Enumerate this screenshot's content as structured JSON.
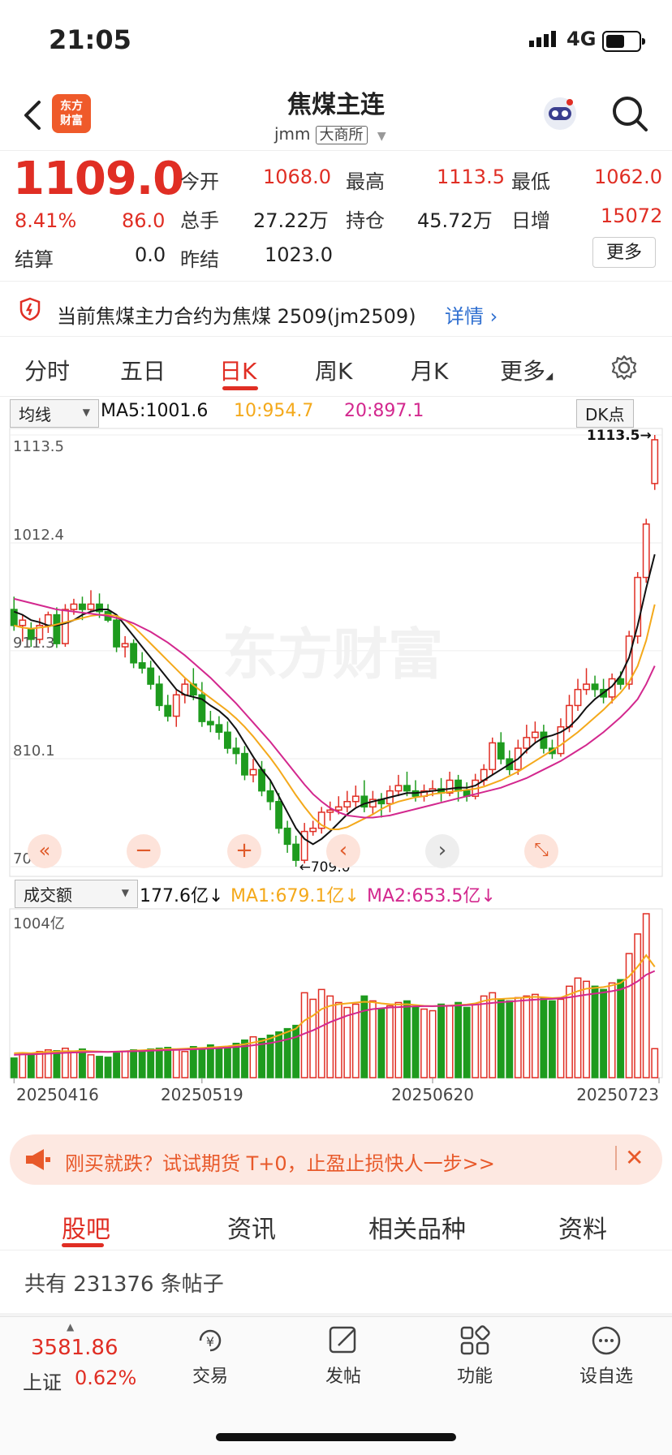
{
  "status": {
    "time": "21:05",
    "network": "4G"
  },
  "header": {
    "title": "焦煤主连",
    "code": "jmm",
    "exchange": "大商所",
    "logo": "东方财富"
  },
  "quote": {
    "price": "1109.0",
    "change_pct": "8.41%",
    "change": "86.0",
    "open_label": "今开",
    "open": "1068.0",
    "high_label": "最高",
    "high": "1113.5",
    "low_label": "最低",
    "low": "1062.0",
    "volume_label": "总手",
    "volume": "27.22万",
    "oi_label": "持仓",
    "oi": "45.72万",
    "daily_inc_label": "日增",
    "daily_inc": "15072",
    "settle_label": "结算",
    "settle": "0.0",
    "prev_settle_label": "昨结",
    "prev_settle": "1023.0",
    "more": "更多"
  },
  "notice": {
    "text": "当前焦煤主力合约为焦煤 2509(jm2509)",
    "link": "详情"
  },
  "tabs": [
    "分时",
    "五日",
    "日K",
    "周K",
    "月K",
    "更多",
    "gear-icon"
  ],
  "ma_bar": {
    "selector": "均线",
    "ma5": "MA5:1001.6",
    "ma10": "10:954.7",
    "ma20": "20:897.1",
    "dk": "DK点"
  },
  "vol_bar": {
    "selector": "成交额",
    "value": "177.6亿",
    "ma1": "MA1:679.1亿",
    "ma2": "MA2:653.5亿"
  },
  "chart_data": {
    "type": "candlestick",
    "price_ticks": [
      "1113.5",
      "1012.4",
      "911.3",
      "810.1",
      "709.0"
    ],
    "ylim": [
      709.0,
      1113.5
    ],
    "high_marker": "1113.5",
    "low_marker": "709.0",
    "vol_max_label": "1004亿",
    "vol_max": 1004,
    "dates": [
      "20250416",
      "20250519",
      "20250620",
      "20250723"
    ],
    "candles": [
      [
        950,
        935,
        962,
        930
      ],
      [
        935,
        940,
        945,
        920
      ],
      [
        932,
        922,
        938,
        915
      ],
      [
        922,
        935,
        942,
        918
      ],
      [
        935,
        945,
        948,
        928
      ],
      [
        945,
        918,
        952,
        914
      ],
      [
        918,
        950,
        955,
        915
      ],
      [
        950,
        955,
        960,
        945
      ],
      [
        955,
        950,
        962,
        940
      ],
      [
        950,
        955,
        968,
        948
      ],
      [
        955,
        948,
        965,
        942
      ],
      [
        948,
        940,
        955,
        938
      ],
      [
        940,
        915,
        945,
        910
      ],
      [
        915,
        918,
        925,
        905
      ],
      [
        918,
        900,
        922,
        895
      ],
      [
        900,
        895,
        910,
        890
      ],
      [
        895,
        880,
        902,
        875
      ],
      [
        880,
        860,
        888,
        855
      ],
      [
        860,
        850,
        870,
        845
      ],
      [
        850,
        870,
        875,
        840
      ],
      [
        870,
        880,
        885,
        862
      ],
      [
        880,
        870,
        895,
        865
      ],
      [
        870,
        845,
        882,
        840
      ],
      [
        845,
        842,
        855,
        835
      ],
      [
        842,
        835,
        850,
        828
      ],
      [
        835,
        820,
        845,
        815
      ],
      [
        820,
        815,
        830,
        805
      ],
      [
        815,
        795,
        822,
        790
      ],
      [
        795,
        800,
        810,
        788
      ],
      [
        800,
        780,
        808,
        775
      ],
      [
        780,
        770,
        790,
        762
      ],
      [
        770,
        745,
        778,
        740
      ],
      [
        745,
        730,
        752,
        722
      ],
      [
        730,
        715,
        738,
        709
      ],
      [
        715,
        742,
        750,
        712
      ],
      [
        742,
        745,
        752,
        738
      ],
      [
        745,
        760,
        765,
        740
      ],
      [
        760,
        762,
        770,
        752
      ],
      [
        762,
        765,
        775,
        758
      ],
      [
        765,
        770,
        780,
        760
      ],
      [
        770,
        775,
        785,
        765
      ],
      [
        775,
        765,
        790,
        760
      ],
      [
        765,
        772,
        780,
        758
      ],
      [
        772,
        768,
        778,
        755
      ],
      [
        768,
        780,
        785,
        760
      ],
      [
        780,
        785,
        795,
        775
      ],
      [
        785,
        780,
        798,
        775
      ],
      [
        780,
        775,
        790,
        770
      ],
      [
        775,
        780,
        786,
        770
      ],
      [
        780,
        782,
        790,
        775
      ],
      [
        782,
        778,
        792,
        770
      ],
      [
        778,
        790,
        798,
        775
      ],
      [
        790,
        780,
        795,
        770
      ],
      [
        780,
        775,
        788,
        770
      ],
      [
        775,
        790,
        796,
        772
      ],
      [
        790,
        800,
        805,
        785
      ],
      [
        800,
        825,
        830,
        795
      ],
      [
        825,
        810,
        835,
        805
      ],
      [
        810,
        800,
        818,
        795
      ],
      [
        800,
        820,
        828,
        795
      ],
      [
        820,
        830,
        842,
        815
      ],
      [
        830,
        835,
        845,
        825
      ],
      [
        835,
        820,
        842,
        815
      ],
      [
        820,
        815,
        828,
        810
      ],
      [
        815,
        840,
        848,
        812
      ],
      [
        840,
        860,
        870,
        835
      ],
      [
        860,
        875,
        885,
        855
      ],
      [
        875,
        880,
        895,
        870
      ],
      [
        880,
        875,
        888,
        868
      ],
      [
        875,
        868,
        885,
        862
      ],
      [
        868,
        885,
        890,
        862
      ],
      [
        885,
        880,
        892,
        875
      ],
      [
        880,
        925,
        930,
        875
      ],
      [
        925,
        980,
        985,
        918
      ],
      [
        980,
        1030,
        1035,
        975
      ],
      [
        1068,
        1109,
        1113.5,
        1062
      ]
    ],
    "volume": [
      120,
      150,
      140,
      160,
      170,
      165,
      180,
      160,
      175,
      140,
      130,
      125,
      150,
      160,
      170,
      165,
      175,
      180,
      185,
      170,
      160,
      190,
      175,
      200,
      185,
      190,
      210,
      230,
      250,
      240,
      260,
      280,
      300,
      320,
      520,
      480,
      540,
      500,
      460,
      430,
      450,
      500,
      470,
      420,
      440,
      460,
      470,
      430,
      420,
      410,
      450,
      440,
      460,
      430,
      450,
      500,
      520,
      480,
      470,
      490,
      500,
      510,
      490,
      470,
      480,
      560,
      610,
      590,
      560,
      540,
      580,
      600,
      760,
      880,
      1004,
      177.6
    ],
    "ma_vol1": [
      150,
      152,
      150,
      155,
      158,
      160,
      162,
      162,
      165,
      162,
      160,
      158,
      160,
      162,
      165,
      168,
      170,
      172,
      175,
      175,
      178,
      180,
      182,
      185,
      188,
      192,
      198,
      205,
      215,
      225,
      240,
      260,
      280,
      300,
      350,
      380,
      420,
      440,
      450,
      455,
      460,
      465,
      462,
      455,
      450,
      448,
      450,
      445,
      440,
      438,
      440,
      442,
      445,
      448,
      455,
      470,
      480,
      482,
      485,
      488,
      492,
      495,
      492,
      488,
      490,
      510,
      530,
      545,
      550,
      555,
      565,
      580,
      620,
      680,
      750,
      679.1
    ],
    "ma_vol2": [
      140,
      142,
      143,
      145,
      147,
      150,
      152,
      154,
      156,
      157,
      158,
      158,
      159,
      160,
      162,
      163,
      165,
      167,
      169,
      170,
      172,
      174,
      176,
      178,
      181,
      184,
      188,
      192,
      198,
      205,
      212,
      222,
      235,
      248,
      270,
      290,
      315,
      340,
      360,
      380,
      395,
      410,
      420,
      425,
      430,
      432,
      435,
      437,
      438,
      438,
      439,
      440,
      442,
      444,
      447,
      452,
      458,
      462,
      466,
      470,
      474,
      478,
      481,
      483,
      486,
      492,
      500,
      508,
      515,
      522,
      530,
      540,
      560,
      590,
      630,
      653.5
    ],
    "ma5": [
      948,
      945,
      940,
      938,
      935,
      935,
      937,
      940,
      945,
      948,
      950,
      950,
      945,
      935,
      925,
      915,
      905,
      895,
      885,
      875,
      870,
      868,
      866,
      860,
      855,
      848,
      838,
      825,
      812,
      800,
      790,
      775,
      760,
      745,
      735,
      730,
      735,
      742,
      750,
      758,
      764,
      768,
      770,
      772,
      774,
      776,
      778,
      778,
      779,
      780,
      781,
      782,
      783,
      783,
      785,
      790,
      795,
      800,
      805,
      810,
      818,
      825,
      830,
      832,
      835,
      840,
      848,
      858,
      866,
      872,
      878,
      888,
      905,
      935,
      970,
      1001.6
    ],
    "ma10": [
      935,
      933,
      932,
      933,
      934,
      936,
      938,
      940,
      942,
      944,
      945,
      945,
      944,
      940,
      934,
      926,
      918,
      910,
      902,
      894,
      886,
      879,
      873,
      867,
      861,
      855,
      848,
      840,
      831,
      821,
      811,
      800,
      788,
      776,
      765,
      755,
      748,
      744,
      744,
      746,
      750,
      754,
      758,
      763,
      767,
      770,
      772,
      774,
      775,
      777,
      778,
      779,
      780,
      781,
      782,
      784,
      787,
      790,
      794,
      798,
      803,
      808,
      813,
      818,
      823,
      829,
      835,
      842,
      849,
      856,
      864,
      872,
      882,
      897,
      921,
      954.7
    ],
    "ma20": [
      960,
      958,
      956,
      954,
      952,
      950,
      949,
      948,
      947,
      946,
      945,
      944,
      942,
      940,
      937,
      933,
      929,
      924,
      919,
      913,
      907,
      900,
      893,
      886,
      878,
      870,
      862,
      853,
      844,
      835,
      826,
      816,
      806,
      796,
      786,
      777,
      770,
      764,
      760,
      757,
      756,
      755,
      755,
      756,
      757,
      759,
      761,
      763,
      765,
      767,
      769,
      771,
      773,
      775,
      777,
      779,
      781,
      783,
      786,
      789,
      792,
      796,
      800,
      804,
      808,
      813,
      818,
      823,
      829,
      835,
      842,
      849,
      857,
      866,
      880,
      897.1
    ]
  },
  "banner": {
    "text": "刚买就跌？试试期货 T+0，止盈止损快人一步>>"
  },
  "sub_tabs": [
    "股吧",
    "资讯",
    "相关品种",
    "资料"
  ],
  "post_count": "共有 231376 条帖子",
  "index": {
    "value": "3581.86",
    "name": "上证",
    "pct": "0.62%"
  },
  "bottom_nav": [
    "交易",
    "发帖",
    "功能",
    "设自选"
  ],
  "colors": {
    "up": "#e02e24",
    "down": "#1e9b1e",
    "ma5": "#111111",
    "ma10": "#f4a91b",
    "ma20": "#d3288e",
    "accent": "#e02e24"
  }
}
